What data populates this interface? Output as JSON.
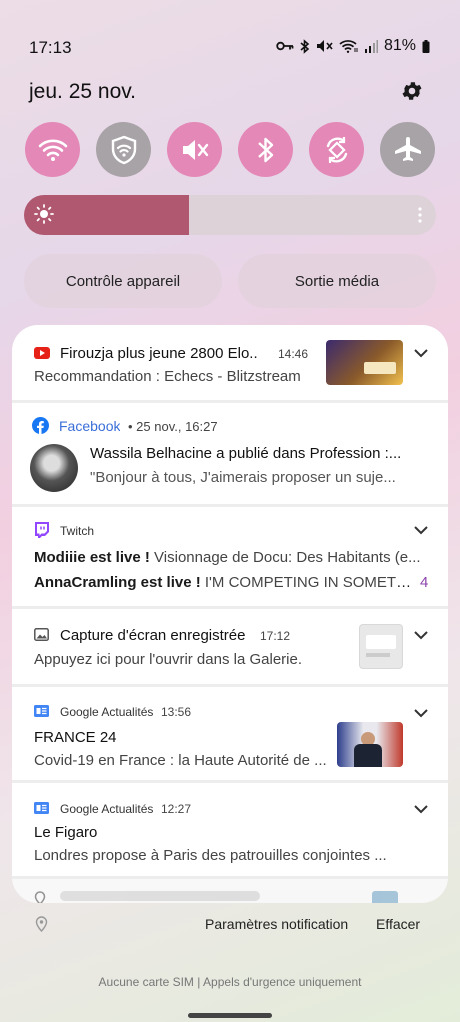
{
  "status": {
    "time": "17:13",
    "battery": "81%"
  },
  "header": {
    "date": "jeu. 25 nov."
  },
  "quick_settings": [
    {
      "name": "wifi",
      "state": "on"
    },
    {
      "name": "secure-wifi",
      "state": "off"
    },
    {
      "name": "sound-mute",
      "state": "on"
    },
    {
      "name": "bluetooth",
      "state": "on"
    },
    {
      "name": "auto-rotate",
      "state": "on"
    },
    {
      "name": "airplane",
      "state": "off"
    }
  ],
  "brightness": {
    "level": 0.4
  },
  "buttons": {
    "device_control": "Contrôle appareil",
    "media_output": "Sortie média"
  },
  "notifications": {
    "youtube": {
      "title": "Firouzja plus jeune 2800 Elo..",
      "time": "14:46",
      "text": "Recommandation : Echecs - Blitzstream"
    },
    "facebook": {
      "app": "Facebook",
      "meta": "• 25 nov., 16:27",
      "title": "Wassila Belhacine a publié dans Profession :...",
      "text": "\"Bonjour à tous, J'aimerais proposer un suje..."
    },
    "twitch": {
      "app": "Twitch",
      "line1_bold": "Modiiie est live !",
      "line1_text": "Visionnage de Docu: Des Habitants (e...",
      "line2_bold": "AnnaCramling est live !",
      "line2_text": "I'M COMPETING IN SOMETHI...",
      "count": "4"
    },
    "screenshot": {
      "title": "Capture d'écran enregistrée",
      "time": "17:12",
      "text": "Appuyez ici pour l'ouvrir dans la Galerie."
    },
    "gnews1": {
      "app": "Google Actualités",
      "time": "13:56",
      "title": "FRANCE 24",
      "text": "Covid-19 en France : la Haute Autorité de ..."
    },
    "gnews2": {
      "app": "Google Actualités",
      "time": "12:27",
      "title": "Le Figaro",
      "text": "Londres propose à Paris des patrouilles conjointes ..."
    }
  },
  "footer": {
    "notif_settings": "Paramètres notification",
    "clear": "Effacer",
    "sim": "Aucune carte SIM | Appels d'urgence uniquement"
  }
}
